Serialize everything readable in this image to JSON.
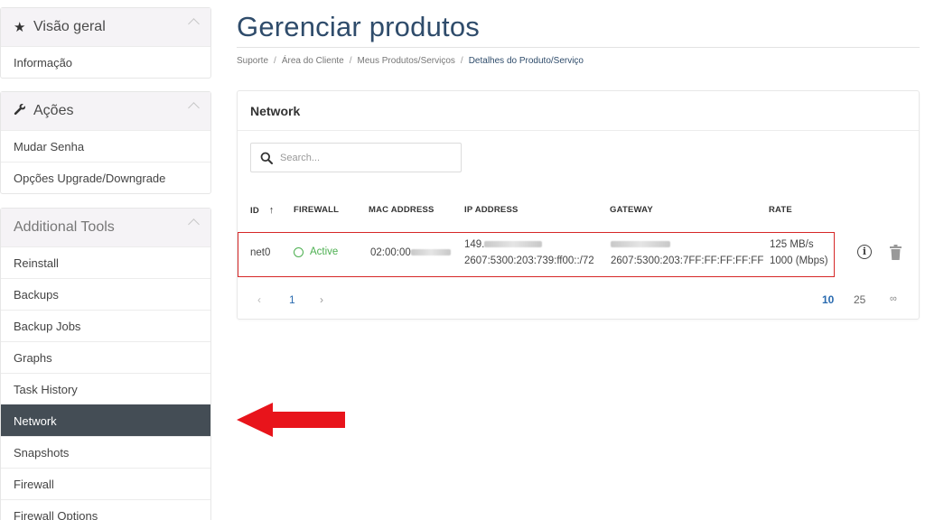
{
  "sidebar": {
    "overview": {
      "title": "Visão geral",
      "icon": "star-icon",
      "items": [
        "Informação"
      ]
    },
    "actions": {
      "title": "Ações",
      "icon": "wrench-icon",
      "items": [
        "Mudar Senha",
        "Opções Upgrade/Downgrade"
      ]
    },
    "tools": {
      "title": "Additional Tools",
      "items": [
        "Reinstall",
        "Backups",
        "Backup Jobs",
        "Graphs",
        "Task History",
        "Network",
        "Snapshots",
        "Firewall",
        "Firewall Options"
      ],
      "active": "Network"
    }
  },
  "page": {
    "title": "Gerenciar produtos",
    "breadcrumb": [
      "Suporte",
      "Área do Cliente",
      "Meus Produtos/Serviços",
      "Detalhes do Produto/Serviço"
    ]
  },
  "network": {
    "heading": "Network",
    "search_placeholder": "Search...",
    "columns": {
      "id": "ID",
      "sort_arrow": "↑",
      "firewall": "FIREWALL",
      "mac": "MAC ADDRESS",
      "ip": "IP ADDRESS",
      "gateway": "GATEWAY",
      "rate": "RATE"
    },
    "row": {
      "id": "net0",
      "firewall": "Active",
      "mac_prefix": "02:00:00",
      "ip_v4_prefix": "149.",
      "ip_v6": "2607:5300:203:739:ff00::/72",
      "gateway_v6": "2607:5300:203:7FF:FF:FF:FF:FF",
      "rate_1": "125 MB/s",
      "rate_2": "1000 (Mbps)"
    },
    "pagination": {
      "prev": "‹",
      "page": "1",
      "next": "›",
      "sizes": [
        "10",
        "25",
        "∞"
      ]
    }
  },
  "colors": {
    "accent": "#2f4c6b",
    "active_bg": "#444d55",
    "status_green": "#4caf50",
    "highlight_red": "#d62727",
    "arrow_red": "#e8141b"
  }
}
